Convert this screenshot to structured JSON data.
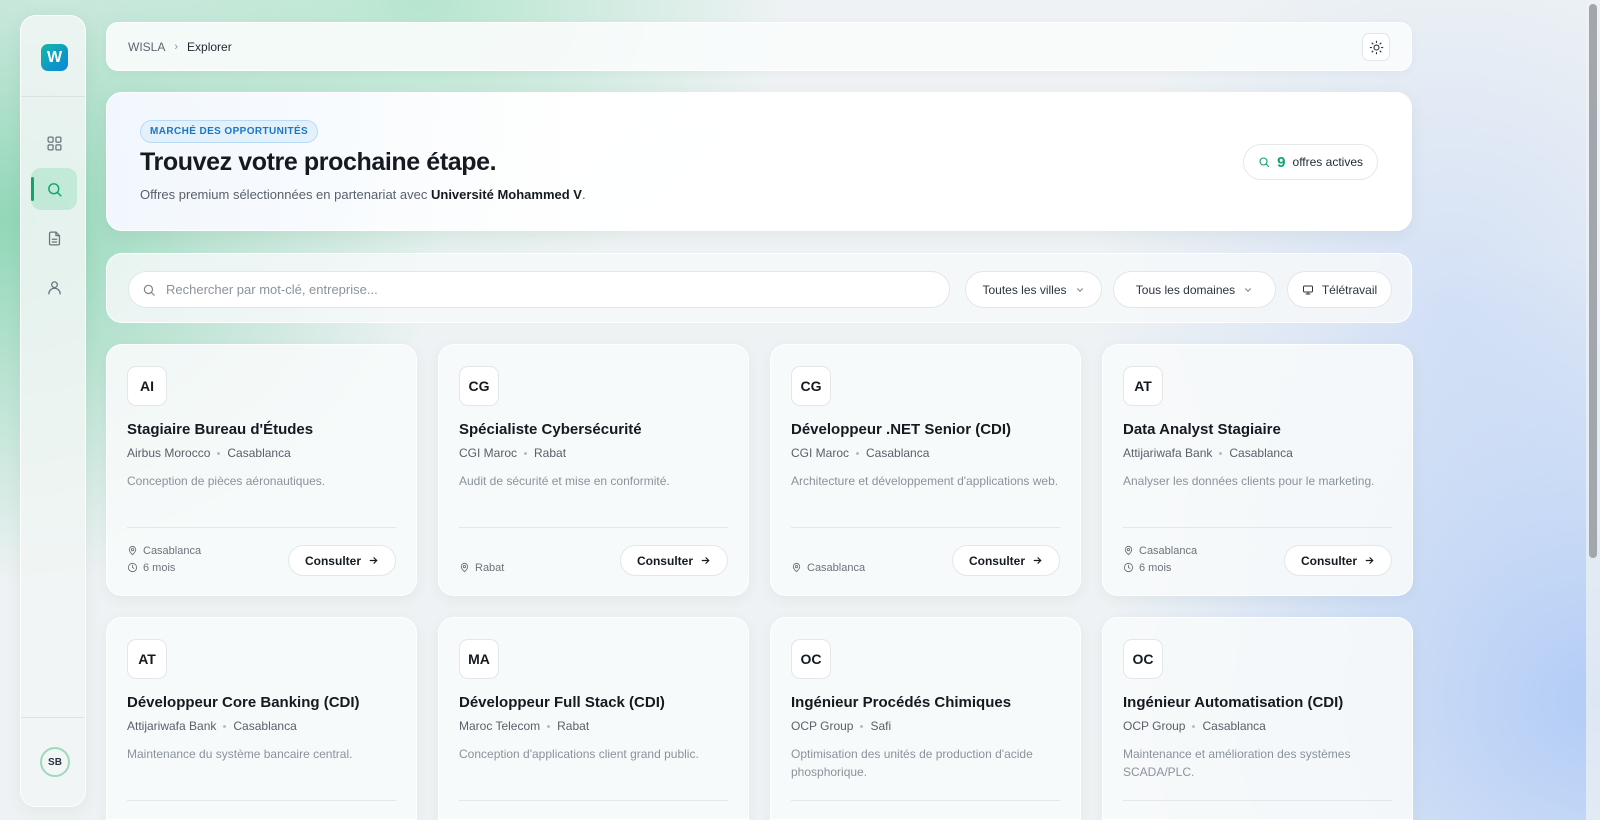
{
  "sidebar": {
    "logo_letter": "W",
    "avatar_initials": "SB",
    "accent_color": "#10a36f"
  },
  "header": {
    "breadcrumb_root": "WISLA",
    "breadcrumb_separator": "›",
    "breadcrumb_current": "Explorer"
  },
  "hero": {
    "badge": "MARCHÉ DES OPPORTUNITÉS",
    "title": "Trouvez votre prochaine étape.",
    "subtitle_prefix": "Offres premium sélectionnées en partenariat avec",
    "partner": "Université Mohammed V",
    "subtitle_suffix": ".",
    "active_count": "9",
    "active_label": "offres actives"
  },
  "filters": {
    "search_placeholder": "Rechercher par mot-clé, entreprise...",
    "city_label": "Toutes les villes",
    "domain_label": "Tous les domaines",
    "remote_label": "Télétravail"
  },
  "cards": [
    {
      "initials": "AI",
      "title": "Stagiaire Bureau d'Études",
      "company": "Airbus Morocco",
      "city": "Casablanca",
      "description": "Conception de pièces aéronautiques.",
      "location": "Casablanca",
      "duration": "6 mois",
      "action": "Consulter"
    },
    {
      "initials": "CG",
      "title": "Spécialiste Cybersécurité",
      "company": "CGI Maroc",
      "city": "Rabat",
      "description": "Audit de sécurité et mise en conformité.",
      "location": "Rabat",
      "duration": "",
      "action": "Consulter"
    },
    {
      "initials": "CG",
      "title": "Développeur .NET Senior (CDI)",
      "company": "CGI Maroc",
      "city": "Casablanca",
      "description": "Architecture et développement d'applications web.",
      "location": "Casablanca",
      "duration": "",
      "action": "Consulter"
    },
    {
      "initials": "AT",
      "title": "Data Analyst Stagiaire",
      "company": "Attijariwafa Bank",
      "city": "Casablanca",
      "description": "Analyser les données clients pour le marketing.",
      "location": "Casablanca",
      "duration": "6 mois",
      "action": "Consulter"
    },
    {
      "initials": "AT",
      "title": "Développeur Core Banking (CDI)",
      "company": "Attijariwafa Bank",
      "city": "Casablanca",
      "description": "Maintenance du système bancaire central.",
      "location": "",
      "duration": "",
      "action": ""
    },
    {
      "initials": "MA",
      "title": "Développeur Full Stack (CDI)",
      "company": "Maroc Telecom",
      "city": "Rabat",
      "description": "Conception d'applications client grand public.",
      "location": "",
      "duration": "",
      "action": ""
    },
    {
      "initials": "OC",
      "title": "Ingénieur Procédés Chimiques",
      "company": "OCP Group",
      "city": "Safi",
      "description": "Optimisation des unités de production d'acide phosphorique.",
      "location": "",
      "duration": "",
      "action": ""
    },
    {
      "initials": "OC",
      "title": "Ingénieur Automatisation (CDI)",
      "company": "OCP Group",
      "city": "Casablanca",
      "description": "Maintenance et amélioration des systèmes SCADA/PLC.",
      "location": "",
      "duration": "",
      "action": ""
    }
  ]
}
